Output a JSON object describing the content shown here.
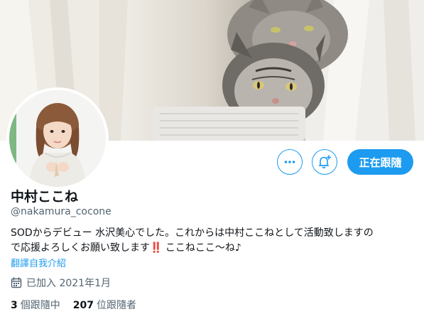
{
  "profile": {
    "display_name": "中村ここね",
    "handle": "@nakamura_cocone",
    "bio_line1": "SODからデビュー 水沢美心でした。これからは中村ここねとして活動致しますの",
    "bio_line2_a": "で応援よろしくお願い致します",
    "bio_emoji": "‼️",
    "bio_line2_b": " ここねここ〜ね♪",
    "translate_label": "翻譯自我介紹",
    "joined_label": "已加入 2021年1月",
    "following_count": "3",
    "following_label": "個跟隨中",
    "followers_count": "207",
    "followers_label": "位跟隨者"
  },
  "actions": {
    "follow_label": "正在跟隨",
    "more_icon": "more-horizontal-icon",
    "notify_icon": "bell-plus-icon"
  },
  "colors": {
    "accent": "#1d9bf0",
    "text": "#0f1419",
    "secondary": "#536471"
  }
}
